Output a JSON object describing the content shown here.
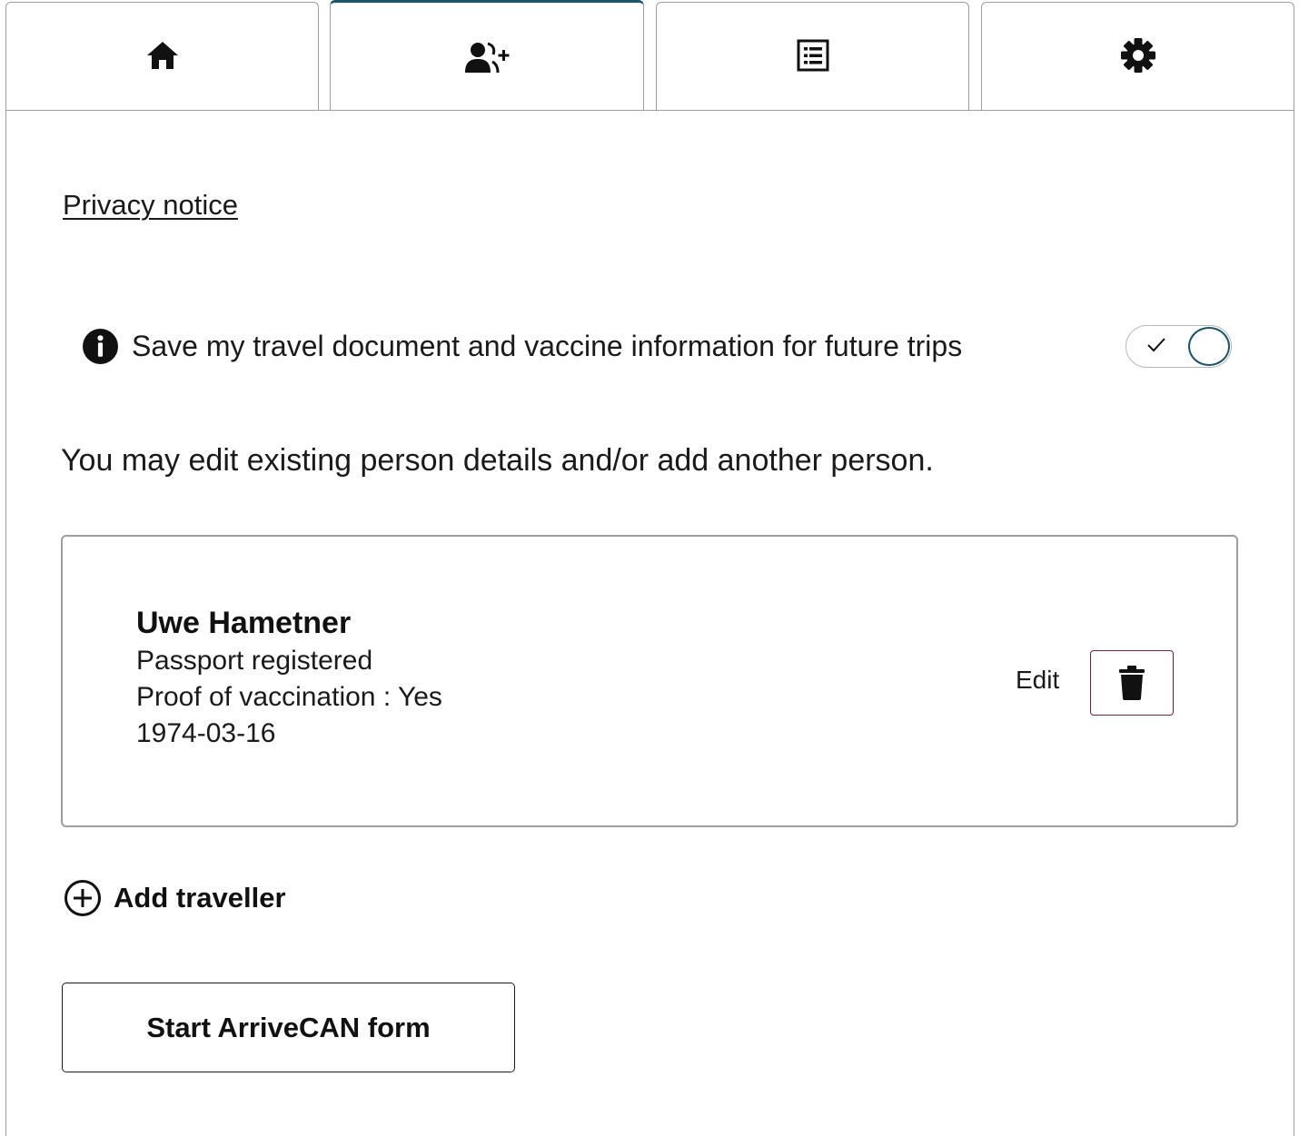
{
  "tabs": [
    {
      "icon": "home-icon",
      "label": "Home"
    },
    {
      "icon": "add-user-icon",
      "label": "Travellers"
    },
    {
      "icon": "list-icon",
      "label": "Submissions"
    },
    {
      "icon": "gear-icon",
      "label": "Settings"
    }
  ],
  "active_tab": 1,
  "privacy_link": "Privacy notice",
  "save_info": {
    "label": "Save my travel document and vaccine information for future trips",
    "toggle_on": true
  },
  "intro_text": "You may edit existing person details and/or add another person.",
  "traveller": {
    "name": "Uwe Hametner",
    "passport": "Passport registered",
    "vaccination": "Proof of vaccination : Yes",
    "dob": "1974-03-16",
    "edit_label": "Edit"
  },
  "add_traveller_label": "Add traveller",
  "start_button_label": "Start ArriveCAN form",
  "colors": {
    "accent": "#1b5566",
    "delete_border": "#7a1f2b",
    "border": "#9e9e9e"
  }
}
